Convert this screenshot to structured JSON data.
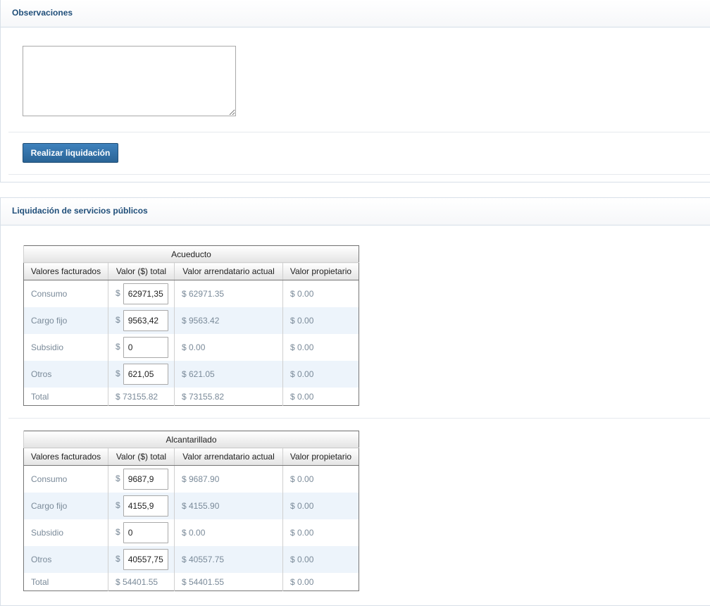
{
  "observaciones": {
    "title": "Observaciones",
    "textarea_value": "",
    "submit_label": "Realizar liquidación"
  },
  "liquidacion": {
    "title": "Liquidación de servicios públicos",
    "columns": [
      "Valores facturados",
      "Valor ($) total",
      "Valor arrendatario actual",
      "Valor propietario"
    ],
    "currency_symbol": "$",
    "acueducto": {
      "title": "Acueducto",
      "rows": [
        {
          "label": "Consumo",
          "input": "62971,35",
          "arrendatario": "$ 62971.35",
          "propietario": "$ 0.00"
        },
        {
          "label": "Cargo fijo",
          "input": "9563,42",
          "arrendatario": "$ 9563.42",
          "propietario": "$ 0.00"
        },
        {
          "label": "Subsidio",
          "input": "0",
          "arrendatario": "$ 0.00",
          "propietario": "$ 0.00"
        },
        {
          "label": "Otros",
          "input": "621,05",
          "arrendatario": "$ 621.05",
          "propietario": "$ 0.00"
        }
      ],
      "total": {
        "label": "Total",
        "total": "$ 73155.82",
        "arrendatario": "$ 73155.82",
        "propietario": "$ 0.00"
      }
    },
    "alcantarillado": {
      "title": "Alcantarillado",
      "rows": [
        {
          "label": "Consumo",
          "input": "9687,9",
          "arrendatario": "$ 9687.90",
          "propietario": "$ 0.00"
        },
        {
          "label": "Cargo fijo",
          "input": "4155,9",
          "arrendatario": "$ 4155.90",
          "propietario": "$ 0.00"
        },
        {
          "label": "Subsidio",
          "input": "0",
          "arrendatario": "$ 0.00",
          "propietario": "$ 0.00"
        },
        {
          "label": "Otros",
          "input": "40557,75",
          "arrendatario": "$ 40557.75",
          "propietario": "$ 0.00"
        }
      ],
      "total": {
        "label": "Total",
        "total": "$ 54401.55",
        "arrendatario": "$ 54401.55",
        "propietario": "$ 0.00"
      }
    }
  }
}
